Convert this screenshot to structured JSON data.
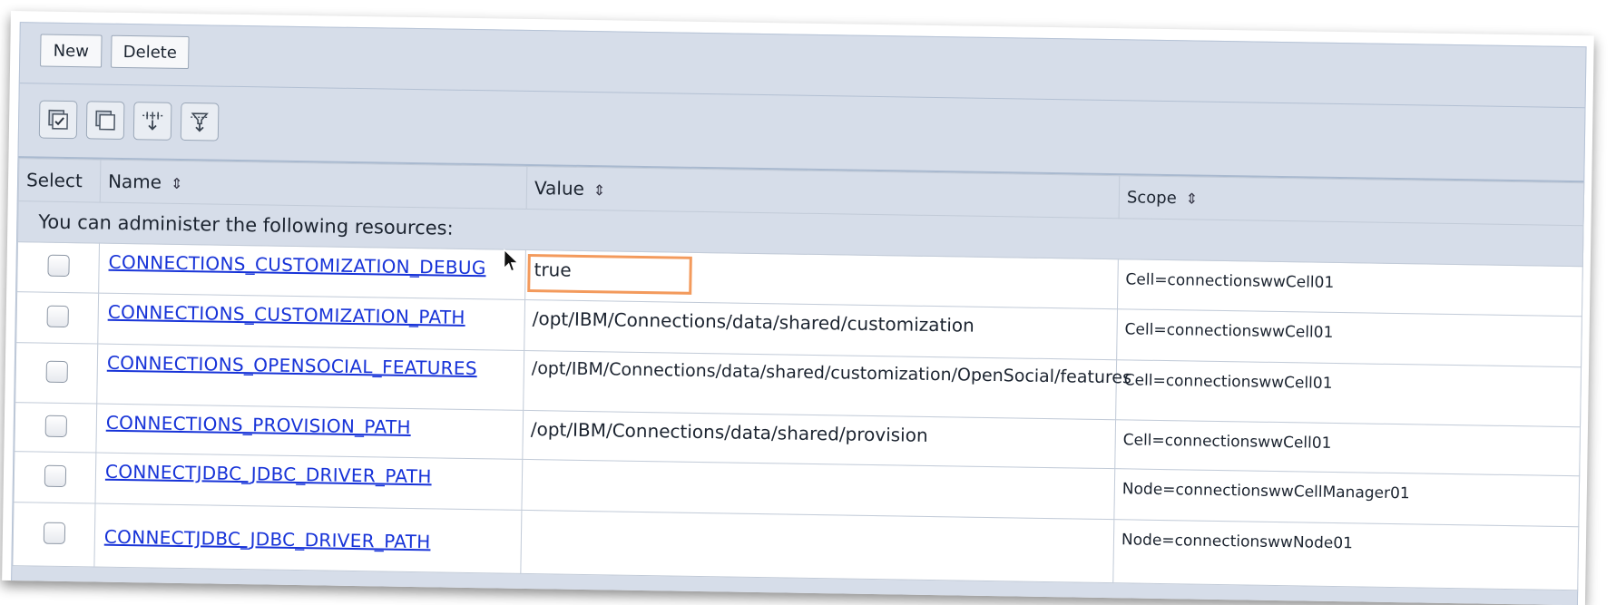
{
  "toolbar": {
    "new_label": "New",
    "delete_label": "Delete",
    "icons": [
      "select-all-icon",
      "deselect-all-icon",
      "add-filter-icon",
      "clear-filter-icon"
    ]
  },
  "table": {
    "columns": {
      "select": "Select",
      "name": "Name",
      "value": "Value",
      "scope": "Scope"
    },
    "info_text": "You can administer the following resources:",
    "rows": [
      {
        "name": "CONNECTIONS_CUSTOMIZATION_DEBUG",
        "value": "true",
        "scope": "Cell=connectionswwCell01",
        "selected": false
      },
      {
        "name": "CONNECTIONS_CUSTOMIZATION_PATH",
        "value": "/opt/IBM/Connections/data/shared/customization",
        "scope": "Cell=connectionswwCell01",
        "selected": false
      },
      {
        "name": "CONNECTIONS_OPENSOCIAL_FEATURES",
        "value": "/opt/IBM/Connections/data/shared/customization/OpenSocial/features",
        "scope": "Cell=connectionswwCell01",
        "selected": false
      },
      {
        "name": "CONNECTIONS_PROVISION_PATH",
        "value": "/opt/IBM/Connections/data/shared/provision",
        "scope": "Cell=connectionswwCell01",
        "selected": false
      },
      {
        "name": "CONNECTJDBC_JDBC_DRIVER_PATH",
        "value": "",
        "scope": "Node=connectionswwCellManager01",
        "selected": false
      },
      {
        "name": "CONNECTJDBC_JDBC_DRIVER_PATH",
        "value": "",
        "scope": "Node=connectionswwNode01",
        "selected": false
      }
    ]
  },
  "colors": {
    "panel": "#d6dde9",
    "link": "#1733d8",
    "highlight": "#f39a5c"
  }
}
